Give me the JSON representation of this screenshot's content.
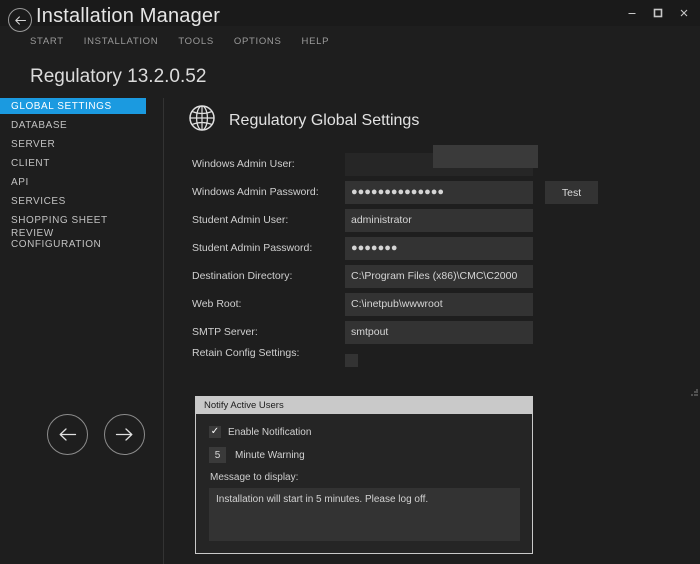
{
  "window": {
    "title": "Installation Manager",
    "back_icon": "back-arrow-icon",
    "controls": {
      "minimize": "—",
      "maximize": "❐",
      "close": "✕"
    }
  },
  "menubar": {
    "items": [
      {
        "label": "START"
      },
      {
        "label": "INSTALLATION"
      },
      {
        "label": "TOOLS"
      },
      {
        "label": "OPTIONS"
      },
      {
        "label": "HELP"
      }
    ]
  },
  "product": {
    "title": "Regulatory 13.2.0.52"
  },
  "sidebar": {
    "items": [
      {
        "label": "GLOBAL SETTINGS",
        "active": true
      },
      {
        "label": "DATABASE",
        "active": false
      },
      {
        "label": "SERVER",
        "active": false
      },
      {
        "label": "CLIENT",
        "active": false
      },
      {
        "label": "API",
        "active": false
      },
      {
        "label": "SERVICES",
        "active": false
      },
      {
        "label": "SHOPPING SHEET",
        "active": false
      },
      {
        "label": "REVIEW CONFIGURATION",
        "active": false
      }
    ],
    "accent_color": "#1b9ae0",
    "nav_back_icon": "arrow-left-icon",
    "nav_next_icon": "arrow-right-icon"
  },
  "content": {
    "icon": "globe-icon",
    "heading": "Regulatory Global Settings",
    "fields": [
      {
        "label": "Windows Admin User:",
        "value": "",
        "type": "text",
        "name": "windows-admin-user",
        "has_popup": true
      },
      {
        "label": "Windows Admin Password:",
        "value": "●●●●●●●●●●●●●●",
        "type": "password",
        "name": "windows-admin-password",
        "has_popup": false
      },
      {
        "label": "Student Admin User:",
        "value": "administrator",
        "type": "text",
        "name": "student-admin-user",
        "has_popup": false
      },
      {
        "label": "Student Admin Password:",
        "value": "●●●●●●●",
        "type": "password",
        "name": "student-admin-password",
        "has_popup": false
      },
      {
        "label": "Destination Directory:",
        "value": "C:\\Program Files (x86)\\CMC\\C2000",
        "type": "text",
        "name": "destination-directory",
        "has_popup": false
      },
      {
        "label": "Web Root:",
        "value": "C:\\inetpub\\wwwroot",
        "type": "text",
        "name": "web-root",
        "has_popup": false
      },
      {
        "label": "SMTP Server:",
        "value": "smtpout",
        "type": "text",
        "name": "smtp-server",
        "has_popup": false
      }
    ],
    "retain_config": {
      "label": "Retain Config Settings:",
      "checked": false
    },
    "test_button": {
      "label": "Test"
    }
  },
  "notify_panel": {
    "header": "Notify Active Users",
    "enable_notification": {
      "label": "Enable Notification",
      "checked": true,
      "check_glyph": "✓"
    },
    "minute_warning": {
      "value": "5",
      "label": "Minute Warning"
    },
    "message_label": "Message to display:",
    "message_value": "Installation will start in 5 minutes. Please log off."
  }
}
